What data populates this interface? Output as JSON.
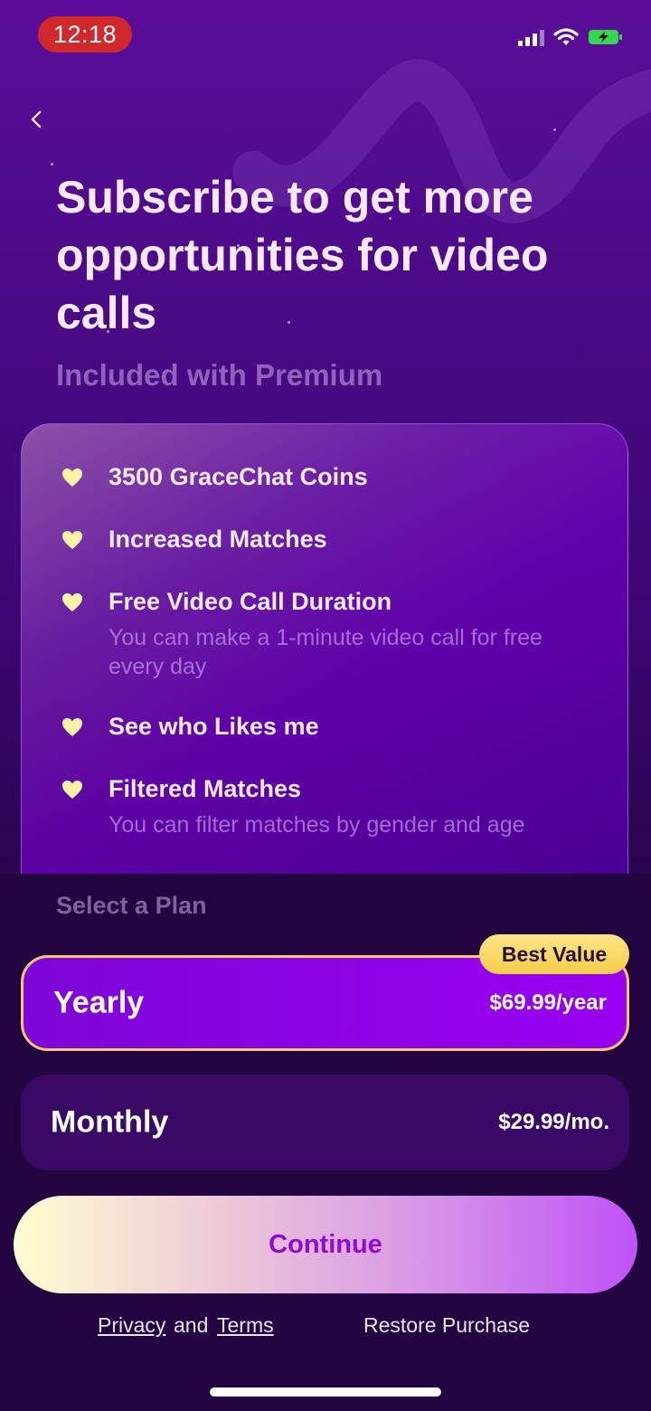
{
  "status_bar": {
    "time": "12:18",
    "icons": [
      "signal-icon",
      "wifi-icon",
      "battery-charging-icon"
    ]
  },
  "navigation": {
    "back_icon": "chevron-left-icon"
  },
  "header": {
    "title": "Subscribe to get more opportunities for video calls",
    "subtitle": "Included with Premium"
  },
  "features": [
    {
      "icon": "heart-icon",
      "title": "3500 GraceChat Coins",
      "description": ""
    },
    {
      "icon": "heart-icon",
      "title": "Increased Matches",
      "description": ""
    },
    {
      "icon": "heart-icon",
      "title": "Free Video Call Duration",
      "description": "You can make a 1-minute video call for free every day"
    },
    {
      "icon": "heart-icon",
      "title": "See who Likes me",
      "description": ""
    },
    {
      "icon": "heart-icon",
      "title": "Filtered Matches",
      "description": "You can filter matches by gender and age"
    }
  ],
  "plans": {
    "heading": "Select a Plan",
    "badge": "Best Value",
    "options": [
      {
        "name": "Yearly",
        "price": "$69.99/year",
        "selected": true
      },
      {
        "name": "Monthly",
        "price": "$29.99/mo.",
        "selected": false
      }
    ]
  },
  "actions": {
    "continue_label": "Continue"
  },
  "footer": {
    "privacy_label": "Privacy",
    "and_label": "and",
    "terms_label": "Terms",
    "restore_label": "Restore Purchase"
  },
  "colors": {
    "background_top": "#5a0d9a",
    "background_bottom": "#16022c",
    "accent_gold": "#f5c96b",
    "heart_yellow": "#fff2a3",
    "selected_plan": "#9000ea",
    "continue_text": "#8e0ad6",
    "status_time_bg": "#d0282b"
  }
}
